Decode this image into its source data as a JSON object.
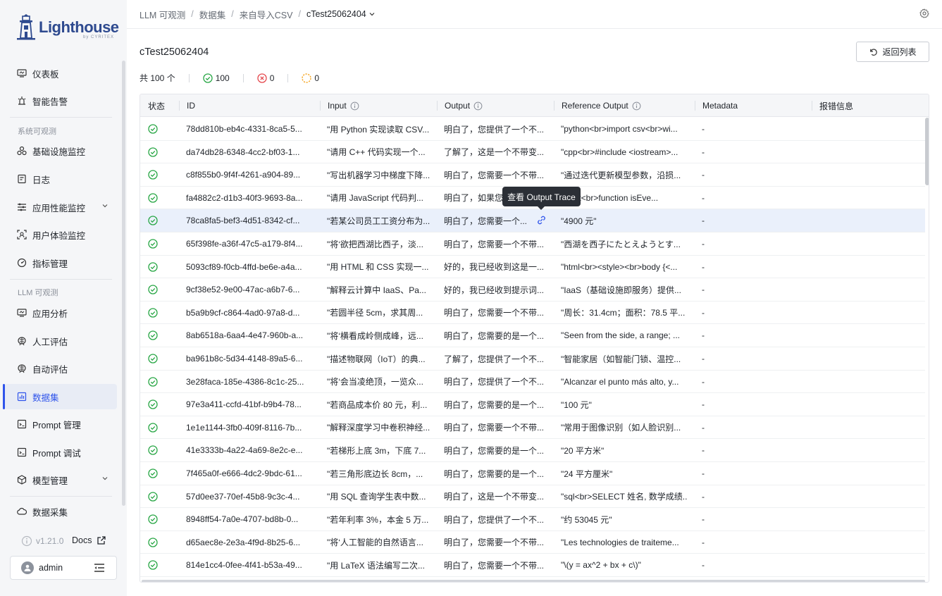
{
  "brand": {
    "name": "Lighthouse",
    "sub": "by CYRITEX"
  },
  "sidebar": {
    "items": [
      {
        "key": "dashboard",
        "label": "仪表板",
        "icon": "monitor-icon"
      },
      {
        "key": "alerts",
        "label": "智能告警",
        "icon": "alarm-icon"
      },
      {
        "key": "infra",
        "label": "基础设施监控",
        "icon": "infra-icon"
      },
      {
        "key": "logs",
        "label": "日志",
        "icon": "log-icon"
      },
      {
        "key": "apm",
        "label": "应用性能监控",
        "icon": "apm-icon"
      },
      {
        "key": "ux",
        "label": "用户体验监控",
        "icon": "ux-icon"
      },
      {
        "key": "metrics",
        "label": "指标管理",
        "icon": "metrics-icon"
      },
      {
        "key": "app-analysis",
        "label": "应用分析",
        "icon": "monitor-icon"
      },
      {
        "key": "human-eval",
        "label": "人工评估",
        "icon": "brain-icon"
      },
      {
        "key": "auto-eval",
        "label": "自动评估",
        "icon": "brain-icon"
      },
      {
        "key": "datasets",
        "label": "数据集",
        "icon": "chart-icon"
      },
      {
        "key": "prompt-mgmt",
        "label": "Prompt 管理",
        "icon": "prompt-icon"
      },
      {
        "key": "prompt-debug",
        "label": "Prompt 调试",
        "icon": "prompt-icon"
      },
      {
        "key": "model-mgmt",
        "label": "模型管理",
        "icon": "model-icon"
      },
      {
        "key": "collect",
        "label": "数据采集",
        "icon": "cloud-icon"
      }
    ],
    "groups": {
      "system": "系统可观测",
      "llm": "LLM 可观测"
    },
    "version": "v1.21.0",
    "docs": "Docs",
    "user": "admin"
  },
  "header": {
    "breadcrumbs": [
      "LLM 可观测",
      "数据集",
      "来自导入CSV"
    ],
    "current": "cTest25062404"
  },
  "page": {
    "title": "cTest25062404",
    "back_label": "返回列表",
    "total_label": "共 100 个",
    "success_count": "100",
    "fail_count": "0",
    "pending_count": "0"
  },
  "table": {
    "columns": [
      "状态",
      "ID",
      "Input",
      "Output",
      "Reference Output",
      "Metadata",
      "报错信息"
    ],
    "tooltip": "查看 Output Trace",
    "rows": [
      {
        "id": "78dd810b-eb4c-4331-8ca5-5...",
        "input": "\"用 Python 实现读取 CSV...",
        "output": "明白了，您提供了一个不...",
        "ref": "\"python<br>import csv<br>wi...",
        "meta": "-"
      },
      {
        "id": "da74db28-6348-4cc2-bf03-1...",
        "input": "\"请用 C++ 代码实现一个...",
        "output": "了解了，这是一个不带变...",
        "ref": "\"cpp<br>#include <iostream>...",
        "meta": "-"
      },
      {
        "id": "c8f855b0-9f4f-4261-a904-89...",
        "input": "\"写出机器学习中梯度下降...",
        "output": "明白了，您需要一个不带...",
        "ref": "\"通过迭代更新模型参数，沿损...",
        "meta": "-"
      },
      {
        "id": "fa4882c2-d1b3-40f3-9693-8a...",
        "input": "\"请用 JavaScript 代码判...",
        "output": "明白了，如果您",
        "ref": "script<br>function isEve...",
        "meta": "-"
      },
      {
        "id": "78ca8fa5-bef3-4d51-8342-cf...",
        "input": "\"若某公司员工工资分布为...",
        "output": "明白了，您需要一个...",
        "ref": "\"4900 元\"",
        "meta": "-"
      },
      {
        "id": "65f398fe-a36f-47c5-a179-8f4...",
        "input": "\"将‘欲把西湖比西子，淡...",
        "output": "明白了，您需要一个不带...",
        "ref": "\"西湖を西子にたとえようとす...",
        "meta": "-"
      },
      {
        "id": "5093cf89-f0cb-4ffd-be6e-a4a...",
        "input": "\"用 HTML 和 CSS 实现一...",
        "output": "好的，我已经收到这是一...",
        "ref": "\"html<br><style><br>body {<...",
        "meta": "-"
      },
      {
        "id": "9cf38e52-9e00-47ac-a6b7-6...",
        "input": "\"解释云计算中 IaaS、Pa...",
        "output": "好的，我已经收到提示词...",
        "ref": "\"IaaS（基础设施即服务）提供...",
        "meta": "-"
      },
      {
        "id": "b5a9b9cf-c864-4ad0-97a8-d...",
        "input": "\"若圆半径 5cm，求其周...",
        "output": "明白了，您需要一个不带...",
        "ref": "\"周长：31.4cm；面积：78.5 平...",
        "meta": "-"
      },
      {
        "id": "8ab6518a-6aa4-4e47-960b-a...",
        "input": "\"将‘横看成岭侧成峰，远...",
        "output": "明白了，您需要的是一个...",
        "ref": "\"Seen from the side, a range; ...",
        "meta": "-"
      },
      {
        "id": "ba961b8c-5d34-4148-89a5-6...",
        "input": "\"描述物联网（IoT）的典...",
        "output": "了解了，您提供了一个不...",
        "ref": "\"智能家居（如智能门锁、温控...",
        "meta": "-"
      },
      {
        "id": "3e28faca-185e-4386-8c1c-25...",
        "input": "\"将‘会当凌绝顶，一览众...",
        "output": "明白了，您提供了一个不...",
        "ref": "\"Alcanzar el punto más alto, y...",
        "meta": "-"
      },
      {
        "id": "97e3a411-ccfd-41bf-b9b4-78...",
        "input": "\"若商品成本价 80 元，利...",
        "output": "明白了，您需要的是一个...",
        "ref": "\"100 元\"",
        "meta": "-"
      },
      {
        "id": "1e1e1144-3fb0-409f-8116-7b...",
        "input": "\"解释深度学习中卷积神经...",
        "output": "明白了，您需要一个不带...",
        "ref": "\"常用于图像识别（如人脸识别...",
        "meta": "-"
      },
      {
        "id": "41e3333b-4a22-4a69-8e2c-e...",
        "input": "\"若梯形上底 3m，下底 7...",
        "output": "明白了，您需要的是一个...",
        "ref": "\"20 平方米\"",
        "meta": "-"
      },
      {
        "id": "7f465a0f-e666-4dc2-9bdc-61...",
        "input": "\"若三角形底边长 8cm，...",
        "output": "明白了，您需要的是一个...",
        "ref": "\"24 平方厘米\"",
        "meta": "-"
      },
      {
        "id": "57d0ee37-70ef-45b8-9c3c-4...",
        "input": "\"用 SQL 查询学生表中数...",
        "output": "明白了，这是一个不带变...",
        "ref": "\"sql<br>SELECT 姓名, 数学成绩...",
        "meta": "-"
      },
      {
        "id": "8948ff54-7a0e-4707-bd8b-0...",
        "input": "\"若年利率 3%，本金 5 万...",
        "output": "明白了，您提供了一个不...",
        "ref": "\"约 53045 元\"",
        "meta": "-"
      },
      {
        "id": "d65aec8e-2e3a-4f9d-8b25-6...",
        "input": "\"将‘人工智能的自然语言...",
        "output": "明白了，您需要一个不带...",
        "ref": "\"Les technologies de traiteme...",
        "meta": "-"
      },
      {
        "id": "814e1cc4-0fee-4f41-b53a-49...",
        "input": "\"用 LaTeX 语法编写二次...",
        "output": "明白了，您需要一个不带...",
        "ref": "\"\\(y = ax^2 + bx + c\\)\"",
        "meta": "-"
      }
    ]
  }
}
